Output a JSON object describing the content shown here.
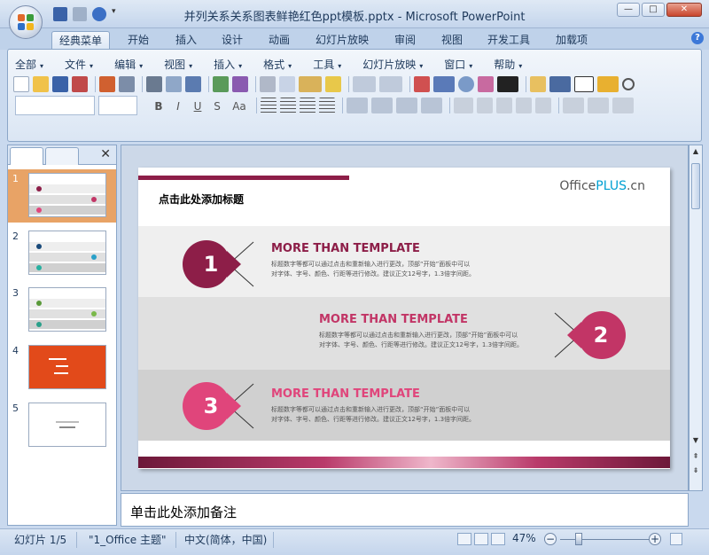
{
  "window": {
    "title": "并列关系关系图表鲜艳红色ppt模板.pptx - Microsoft PowerPoint",
    "minimize": "—",
    "maximize": "□",
    "close": "✕"
  },
  "help_icon": "?",
  "tabs": [
    "经典菜单",
    "开始",
    "插入",
    "设计",
    "动画",
    "幻灯片放映",
    "审阅",
    "视图",
    "开发工具",
    "加载项"
  ],
  "menus": [
    "全部",
    "文件",
    "编辑",
    "视图",
    "插入",
    "格式",
    "工具",
    "幻灯片放映",
    "窗口",
    "帮助"
  ],
  "format_buttons": [
    "B",
    "I",
    "U",
    "S",
    "Aa"
  ],
  "panel_close": "✕",
  "thumbnails": [
    "1",
    "2",
    "3",
    "4",
    "5"
  ],
  "slide": {
    "title": "点击此处添加标题",
    "logo_prefix": "Office",
    "logo_highlight": "PLUS",
    "logo_suffix": ".cn",
    "items": [
      {
        "number": "1",
        "heading": "MORE THAN TEMPLATE",
        "text1": "标题数字等都可以通过点击和重新输入进行更改，顶部“开始”面板中可以",
        "text2": "对字体、字号、颜色、行距等进行修改。建议正文12号字，1.3倍字间距。"
      },
      {
        "number": "2",
        "heading": "MORE THAN TEMPLATE",
        "text1": "标题数字等都可以通过点击和重新输入进行更改，顶部“开始”面板中可以",
        "text2": "对字体、字号、颜色、行距等进行修改。建议正文12号字，1.3倍字间距。"
      },
      {
        "number": "3",
        "heading": "MORE THAN TEMPLATE",
        "text1": "标题数字等都可以通过点击和重新输入进行更改，顶部“开始”面板中可以",
        "text2": "对字体、字号、颜色、行距等进行修改。建议正文12号字，1.3倍字间距。"
      }
    ],
    "colors": {
      "dark_red": "#8d1e48",
      "red": "#c23566",
      "pink": "#e0457b",
      "band1": "#efefef",
      "band2": "#e0e0e0",
      "band3": "#d0d0d0"
    }
  },
  "notes_placeholder": "单击此处添加备注",
  "status": {
    "slide": "幻灯片 1/5",
    "theme": "\"1_Office 主题\"",
    "language": "中文(简体，中国)",
    "zoom": "47%",
    "zoom_level_percent": 47
  }
}
